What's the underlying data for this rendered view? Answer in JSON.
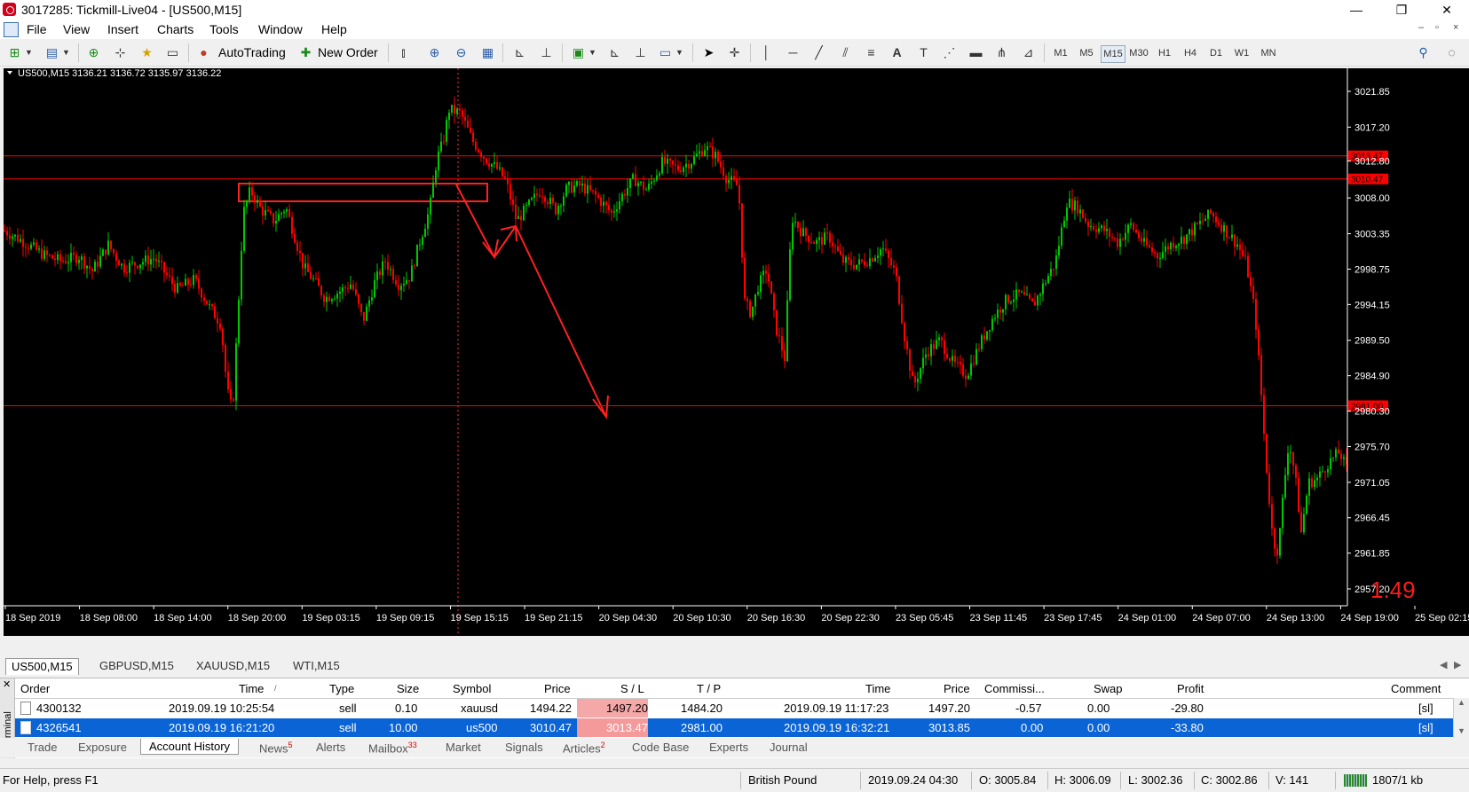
{
  "window": {
    "title": "3017285: Tickmill-Live04 - [US500,M15]",
    "minimize": "—",
    "restore": "❐",
    "close": "✕"
  },
  "menu": [
    "File",
    "View",
    "Insert",
    "Charts",
    "Tools",
    "Window",
    "Help"
  ],
  "toolbar": {
    "autotrading": "AutoTrading",
    "new_order": "New Order",
    "timeframes": [
      "M1",
      "M5",
      "M15",
      "M30",
      "H1",
      "H4",
      "D1",
      "W1",
      "MN"
    ],
    "active_timeframe": "M15"
  },
  "chart": {
    "header": "US500,M15  3136.21 3136.72 3135.97 3136.22",
    "corner_value": "1.49",
    "price_labels": [
      "3021.85",
      "3017.20",
      "3012.80",
      "3008.00",
      "3003.35",
      "2998.75",
      "2994.15",
      "2989.50",
      "2984.90",
      "2980.30",
      "2975.70",
      "2971.05",
      "2966.45",
      "2961.85",
      "2957.20"
    ],
    "marker_labels": [
      "3013.47",
      "3010.47",
      "2981.00"
    ],
    "time_labels": [
      "18 Sep 2019",
      "18 Sep 08:00",
      "18 Sep 14:00",
      "18 Sep 20:00",
      "19 Sep 03:15",
      "19 Sep 09:15",
      "19 Sep 15:15",
      "19 Sep 21:15",
      "20 Sep 04:30",
      "20 Sep 10:30",
      "20 Sep 16:30",
      "20 Sep 22:30",
      "23 Sep 05:45",
      "23 Sep 11:45",
      "23 Sep 17:45",
      "24 Sep 01:00",
      "24 Sep 07:00",
      "24 Sep 13:00",
      "24 Sep 19:00",
      "25 Sep 02:15"
    ],
    "colors": {
      "bull": "#00c800",
      "bear": "#ff0000",
      "line": "#ff0000",
      "background": "#000000"
    }
  },
  "chart_data": {
    "type": "candlestick",
    "symbol": "US500",
    "timeframe": "M15",
    "y_range": [
      2955.0,
      3024.0
    ],
    "horizontal_lines": [
      3013.47,
      3010.47,
      2981.0
    ],
    "close_path": [
      [
        0,
        3003.8
      ],
      [
        20,
        3002.5
      ],
      [
        45,
        3000.6
      ],
      [
        65,
        2999.8
      ],
      [
        85,
        3000.4
      ],
      [
        100,
        2998.5
      ],
      [
        118,
        3001.9
      ],
      [
        135,
        2998.9
      ],
      [
        155,
        2999.7
      ],
      [
        170,
        3000.2
      ],
      [
        195,
        2996.1
      ],
      [
        215,
        2997.4
      ],
      [
        232,
        2993.8
      ],
      [
        245,
        2991.6
      ],
      [
        252,
        2983.0
      ],
      [
        258,
        2980.2
      ],
      [
        264,
        2993.0
      ],
      [
        270,
        3006.0
      ],
      [
        278,
        3009.0
      ],
      [
        290,
        3006.5
      ],
      [
        305,
        3005.0
      ],
      [
        318,
        3006.8
      ],
      [
        328,
        3003.0
      ],
      [
        338,
        2999.0
      ],
      [
        350,
        2997.2
      ],
      [
        362,
        2995.0
      ],
      [
        378,
        2995.8
      ],
      [
        392,
        2996.9
      ],
      [
        405,
        2992.0
      ],
      [
        418,
        2997.0
      ],
      [
        430,
        2999.8
      ],
      [
        445,
        2996.8
      ],
      [
        458,
        2997.8
      ],
      [
        470,
        3002.8
      ],
      [
        480,
        3006.5
      ],
      [
        488,
        3013.0
      ],
      [
        495,
        3015.2
      ],
      [
        502,
        3019.5
      ],
      [
        515,
        3019.0
      ],
      [
        528,
        3015.5
      ],
      [
        542,
        3013.2
      ],
      [
        556,
        3011.8
      ],
      [
        566,
        3010.2
      ],
      [
        578,
        3005.0
      ],
      [
        590,
        3006.8
      ],
      [
        605,
        3009.0
      ],
      [
        622,
        3006.5
      ],
      [
        635,
        3009.3
      ],
      [
        650,
        3009.6
      ],
      [
        668,
        3008.2
      ],
      [
        685,
        3006.0
      ],
      [
        698,
        3008.5
      ],
      [
        710,
        3010.5
      ],
      [
        725,
        3009.0
      ],
      [
        742,
        3012.6
      ],
      [
        760,
        3011.8
      ],
      [
        775,
        3012.8
      ],
      [
        790,
        3014.6
      ],
      [
        802,
        3013.5
      ],
      [
        815,
        3010.5
      ],
      [
        828,
        3009.5
      ],
      [
        835,
        2994.5
      ],
      [
        842,
        2993.0
      ],
      [
        850,
        2996.5
      ],
      [
        860,
        2998.8
      ],
      [
        870,
        2991.2
      ],
      [
        880,
        2987.2
      ],
      [
        888,
        3005.5
      ],
      [
        900,
        3003.5
      ],
      [
        915,
        3002.2
      ],
      [
        930,
        3003.0
      ],
      [
        945,
        2999.8
      ],
      [
        960,
        2999.3
      ],
      [
        975,
        3000.0
      ],
      [
        990,
        3001.5
      ],
      [
        1005,
        2998.2
      ],
      [
        1015,
        2990.0
      ],
      [
        1025,
        2983.5
      ],
      [
        1040,
        2988.0
      ],
      [
        1055,
        2989.5
      ],
      [
        1070,
        2986.5
      ],
      [
        1085,
        2985.0
      ],
      [
        1100,
        2989.0
      ],
      [
        1115,
        2992.5
      ],
      [
        1130,
        2994.8
      ],
      [
        1145,
        2995.5
      ],
      [
        1160,
        2994.0
      ],
      [
        1172,
        2996.8
      ],
      [
        1185,
        2999.6
      ],
      [
        1198,
        3007.5
      ],
      [
        1210,
        3006.8
      ],
      [
        1222,
        3004.6
      ],
      [
        1240,
        3003.8
      ],
      [
        1255,
        3002.2
      ],
      [
        1270,
        3004.5
      ],
      [
        1285,
        3002.0
      ],
      [
        1300,
        3000.5
      ],
      [
        1315,
        3002.0
      ],
      [
        1330,
        3002.8
      ],
      [
        1345,
        3004.4
      ],
      [
        1360,
        3006.0
      ],
      [
        1375,
        3004.0
      ],
      [
        1390,
        3002.0
      ],
      [
        1400,
        2999.5
      ],
      [
        1410,
        2993.0
      ],
      [
        1416,
        2984.0
      ],
      [
        1422,
        2974.0
      ],
      [
        1430,
        2963.5
      ],
      [
        1436,
        2962.0
      ],
      [
        1442,
        2970.0
      ],
      [
        1448,
        2976.5
      ],
      [
        1455,
        2972.0
      ],
      [
        1462,
        2964.5
      ],
      [
        1470,
        2971.0
      ],
      [
        1480,
        2971.5
      ],
      [
        1492,
        2973.5
      ],
      [
        1505,
        2975.0
      ],
      [
        1514,
        2972.5
      ]
    ]
  },
  "symbol_tabs": [
    "US500,M15",
    "GBPUSD,M15",
    "XAUUSD,M15",
    "WTI,M15"
  ],
  "terminal": {
    "label": "Terminal",
    "columns": [
      "Order",
      "Time",
      "Type",
      "Size",
      "Symbol",
      "Price",
      "S / L",
      "T / P",
      "Time",
      "Price",
      "Commissi...",
      "Swap",
      "Profit",
      "Comment"
    ],
    "rows": [
      [
        "4300132",
        "2019.09.19 10:25:54",
        "sell",
        "0.10",
        "xauusd",
        "1494.22",
        "1497.20",
        "1484.20",
        "2019.09.19 11:17:23",
        "1497.20",
        "-0.57",
        "0.00",
        "-29.80",
        "[sl]"
      ],
      [
        "4326541",
        "2019.09.19 16:21:20",
        "sell",
        "10.00",
        "us500",
        "3010.47",
        "3013.47",
        "2981.00",
        "2019.09.19 16:32:21",
        "3013.85",
        "0.00",
        "0.00",
        "-33.80",
        "[sl]"
      ]
    ],
    "tabs": [
      {
        "label": "Trade",
        "badge": ""
      },
      {
        "label": "Exposure",
        "badge": ""
      },
      {
        "label": "Account History",
        "badge": ""
      },
      {
        "label": "News",
        "badge": "5"
      },
      {
        "label": "Alerts",
        "badge": ""
      },
      {
        "label": "Mailbox",
        "badge": "33"
      },
      {
        "label": "Market",
        "badge": ""
      },
      {
        "label": "Signals",
        "badge": ""
      },
      {
        "label": "Articles",
        "badge": "2"
      },
      {
        "label": "Code Base",
        "badge": ""
      },
      {
        "label": "Experts",
        "badge": ""
      },
      {
        "label": "Journal",
        "badge": ""
      }
    ],
    "active_tab": "Account History"
  },
  "status": {
    "help": "For Help, press F1",
    "profile": "British Pound",
    "datetime": "2019.09.24 04:30",
    "open": "O: 3005.84",
    "high": "H: 3006.09",
    "low": "L: 3002.36",
    "close": "C: 3002.86",
    "volume": "V: 141",
    "traffic": "1807/1 kb"
  }
}
